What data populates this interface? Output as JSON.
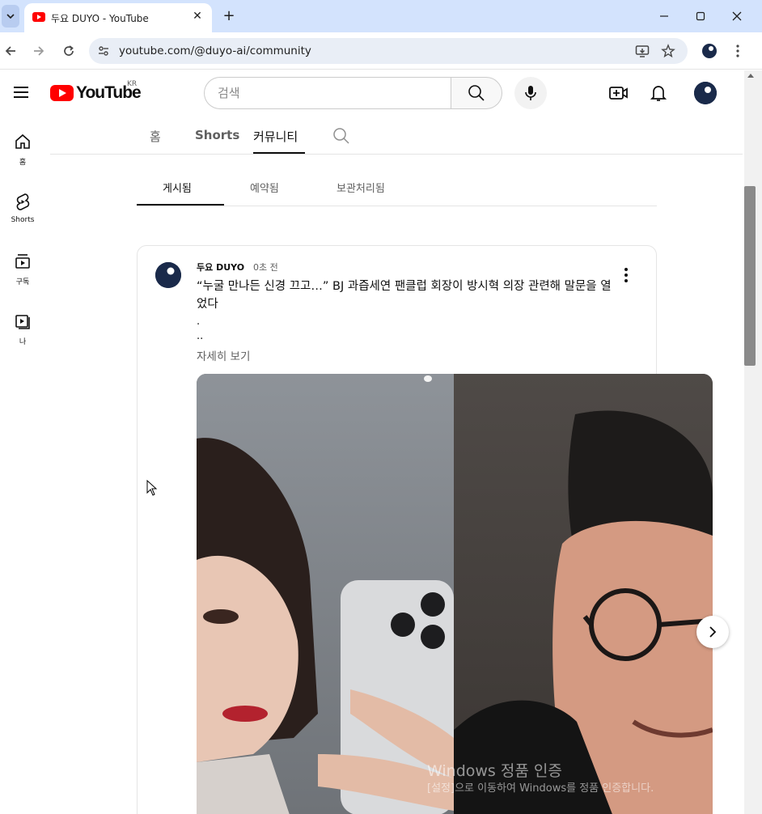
{
  "browser": {
    "tab_title": "두요 DUYO - YouTube",
    "url": "youtube.com/@duyo-ai/community",
    "new_tab_label": "+",
    "close_label": "✕"
  },
  "masthead": {
    "logo_text": "YouTube",
    "region": "KR",
    "search_placeholder": "검색"
  },
  "guide": {
    "items": [
      {
        "label": "홈",
        "icon": "home-icon"
      },
      {
        "label": "Shorts",
        "icon": "shorts-icon"
      },
      {
        "label": "구독",
        "icon": "subscriptions-icon"
      },
      {
        "label": "나",
        "icon": "you-icon"
      }
    ]
  },
  "channel_tabs": {
    "items": [
      "홈",
      "Shorts",
      "커뮤니티"
    ],
    "active": "커뮤니티"
  },
  "sub_tabs": {
    "items": [
      "게시됨",
      "예약됨",
      "보관처리됨"
    ],
    "active": "게시됨"
  },
  "post": {
    "author": "두요 DUYO",
    "time": "0초 전",
    "text": "“누굴 만나든 신경 끄고…” BJ 과즙세연 팬클럽 회장이 방시혁 의장 관련해 말문을 열었다",
    "dot1": ".",
    "dot2": "..",
    "more_label": "자세히 보기"
  },
  "watermark": {
    "line1": "Windows 정품 인증",
    "line2": "[설정]으로 이동하여 Windows를 정품 인증합니다."
  },
  "colors": {
    "brand_red": "#ff0000",
    "tab_strip": "#d3e3fd",
    "omnibox": "#e9eef6"
  }
}
